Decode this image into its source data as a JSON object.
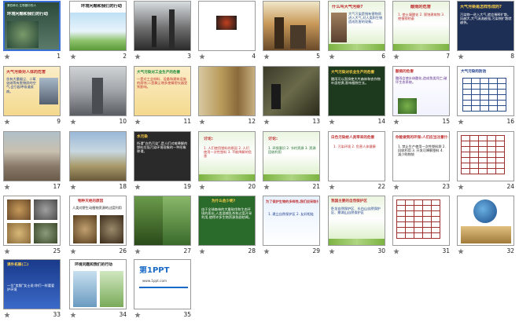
{
  "slides": [
    {
      "num": "1",
      "title": "环境问题和我们的行动",
      "header": "第四单元 生物圈中的人",
      "theme": "title"
    },
    {
      "num": "2",
      "title": "环境问题和我们的行动",
      "theme": "nature"
    },
    {
      "num": "3",
      "title": "",
      "theme": "smoke"
    },
    {
      "num": "4",
      "title": "",
      "theme": "dark"
    },
    {
      "num": "5",
      "title": "",
      "theme": "factory"
    },
    {
      "num": "6",
      "title": "什么叫大气污染?",
      "body": "大气污染是指有害物质进入大气,对人类和生物造成危害的现象。",
      "theme": "textgreen"
    },
    {
      "num": "7",
      "title": "酸雨的危害",
      "body": "1. 使土壤酸化 2. 腐蚀建筑物 3. 使植物枯萎",
      "theme": "textgreen2"
    },
    {
      "num": "8",
      "title": "大气污染是怎样形成的?",
      "body": "污染物一进入大气,就会稀释扩散。风越大,大气湍流越强,污染物扩散就越快。",
      "theme": "dark-text"
    },
    {
      "num": "9",
      "title": "大气污染对人体的危害",
      "body": "含有大量烟尘、二氧化硫等有害物质的空气,会引起呼吸道疾病。",
      "theme": "textyellow"
    },
    {
      "num": "10",
      "title": "",
      "theme": "citysmog"
    },
    {
      "num": "11",
      "title": "大气污染对工业生产的危害",
      "body": "一是对工业材料、设备和建筑设施的腐蚀;二是飘尘增多使精密仪器受到影响。",
      "theme": "textyellow2"
    },
    {
      "num": "12",
      "title": "",
      "theme": "wheat"
    },
    {
      "num": "13",
      "title": "",
      "theme": "farm"
    },
    {
      "num": "14",
      "title": "大气污染对农业生产的危害",
      "body": "酸雨可以直接使大片森林和农作物叶面枯黄,影响植物生长。",
      "theme": "darkgreen"
    },
    {
      "num": "15",
      "title": "酸雨的危害",
      "body": "酸雨会使水体酸化,造成鱼类死亡,破坏生态系统。",
      "theme": "textpurple"
    },
    {
      "num": "16",
      "title": "大气污染的防治",
      "theme": "table"
    },
    {
      "num": "17",
      "title": "",
      "theme": "garbage"
    },
    {
      "num": "18",
      "title": "",
      "theme": "land"
    },
    {
      "num": "19",
      "title": "水污染",
      "body": "所谓“白色污染”,是人们对难降解的塑料垃圾污染环境现象的一种形象称谓。",
      "theme": "darkbody"
    },
    {
      "num": "20",
      "title": "讨论:",
      "body": "1. 人们使用塑料的原因 2. 人们使用一次性塑料 3. 不能降解的危害",
      "theme": "redlist"
    },
    {
      "num": "21",
      "title": "讨论:",
      "body": "1. 环保意识 2. 节约资源 3. 资源回收利用",
      "theme": "greenlist"
    },
    {
      "num": "22",
      "title": "白色污染给人类带来的危害",
      "body": "1. 污染环境 2. 危害人体健康",
      "theme": "textpink"
    },
    {
      "num": "23",
      "title": "你能做到的环保:人们应当注意什么",
      "body": "1. 禁止生产使用一次性塑料袋 2. 回收利用 3. 开发可降解塑料 4. 减少购物袋",
      "theme": "textpink2"
    },
    {
      "num": "24",
      "title": "",
      "theme": "table2"
    },
    {
      "num": "25",
      "title": "",
      "theme": "animals"
    },
    {
      "num": "26",
      "title": "物种灭绝的原因",
      "body": "人类对野生动植物资源的过度利用",
      "theme": "animals2"
    },
    {
      "num": "27",
      "title": "",
      "theme": "forest"
    },
    {
      "num": "28",
      "title": "为什么会少呢?",
      "body": "由于全球森林的大量砍伐和生态环境的恶化,人类滥捕乱杀和过度开采利用,使得许多生物资源急剧枯竭。",
      "theme": "greenbig"
    },
    {
      "num": "29",
      "title": "为了保护生物的多样性,我们应采取什么措施",
      "body": "1. 建立自然保护区 2. 友好相处",
      "theme": "bluelist"
    },
    {
      "num": "30",
      "title": "我国主要的自然保护区",
      "body": "卧龙自然保护区、长白山自然保护区、鼎湖山自然保护区",
      "theme": "bluelist2"
    },
    {
      "num": "31",
      "title": "",
      "theme": "table3"
    },
    {
      "num": "32",
      "title": "",
      "theme": "earth"
    },
    {
      "num": "33",
      "title": "课外拓展(二)",
      "body": "一位“卖猫”女士说:你们一样要爱护环境",
      "theme": "bluetext"
    },
    {
      "num": "34",
      "title": "环境问题和我们的行动",
      "theme": "closing"
    },
    {
      "num": "35",
      "title": "第1PPT",
      "body": "www.1ppt.com",
      "theme": "logo"
    }
  ],
  "icons": {
    "animation": "star-animation-icon"
  }
}
